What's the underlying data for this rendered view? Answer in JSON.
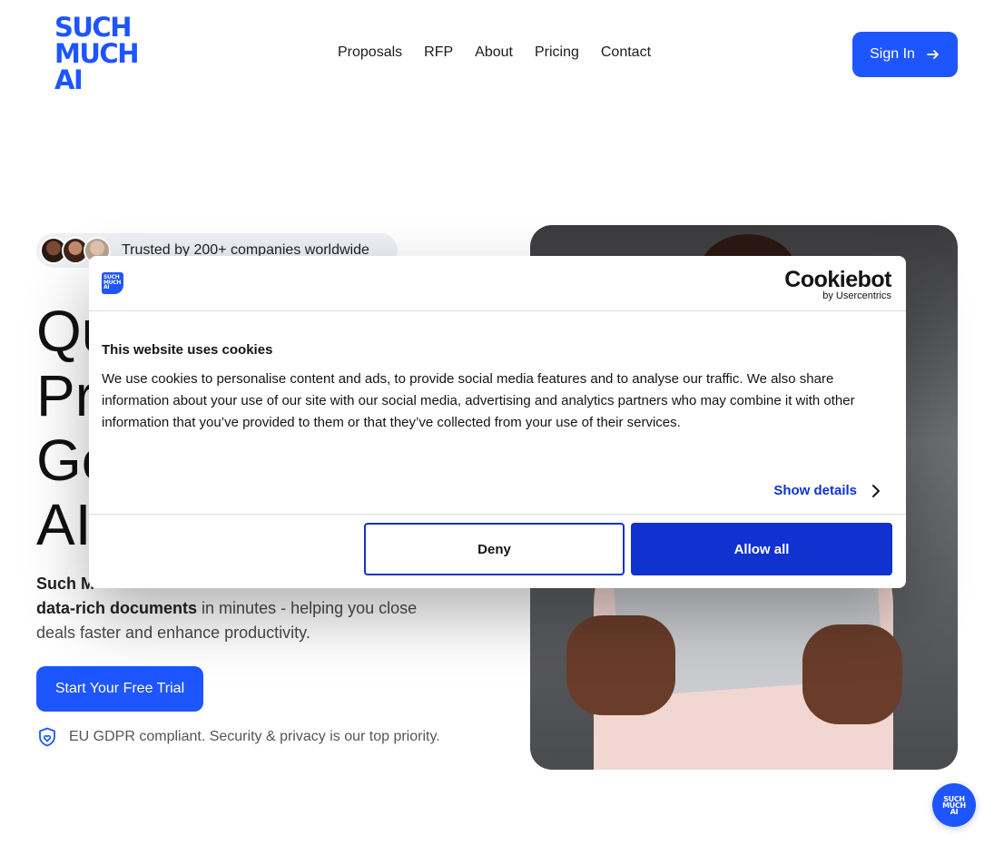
{
  "header": {
    "logo_lines": [
      "SUCH",
      "MUCH",
      "AI"
    ],
    "nav": [
      "Proposals",
      "RFP",
      "About",
      "Pricing",
      "Contact"
    ],
    "signin_label": "Sign In"
  },
  "hero": {
    "trust_prefix": "Trusted by 200+",
    "trust_suffix": "companies worldwide",
    "headline_lines": [
      "Qu",
      "Pr",
      "Ge",
      "AI"
    ],
    "sub_bold_1": "Such M",
    "sub_bold_2": "data-rich documents",
    "sub_rest_1": "in minutes - helping you close",
    "sub_rest_2": "deals faster and enhance productivity.",
    "cta_label": "Start Your Free Trial",
    "gdpr_text": "EU GDPR compliant. Security & privacy is our top priority."
  },
  "chat": {
    "label_lines": [
      "SUCH",
      "MUCH",
      "AI"
    ]
  },
  "cookie": {
    "brand": "Cookiebot",
    "brand_sub": "by Usercentrics",
    "title": "This website uses cookies",
    "text": "We use cookies to personalise content and ads, to provide social media features and to analyse our traffic. We also share information about your use of our site with our social media, advertising and analytics partners who may combine it with other information that you’ve provided to them or that they’ve collected from your use of their services.",
    "show_details": "Show details",
    "deny": "Deny",
    "allow_all": "Allow all"
  },
  "colors": {
    "brand": "#1d55ff",
    "cookie_accent": "#1032cf"
  }
}
